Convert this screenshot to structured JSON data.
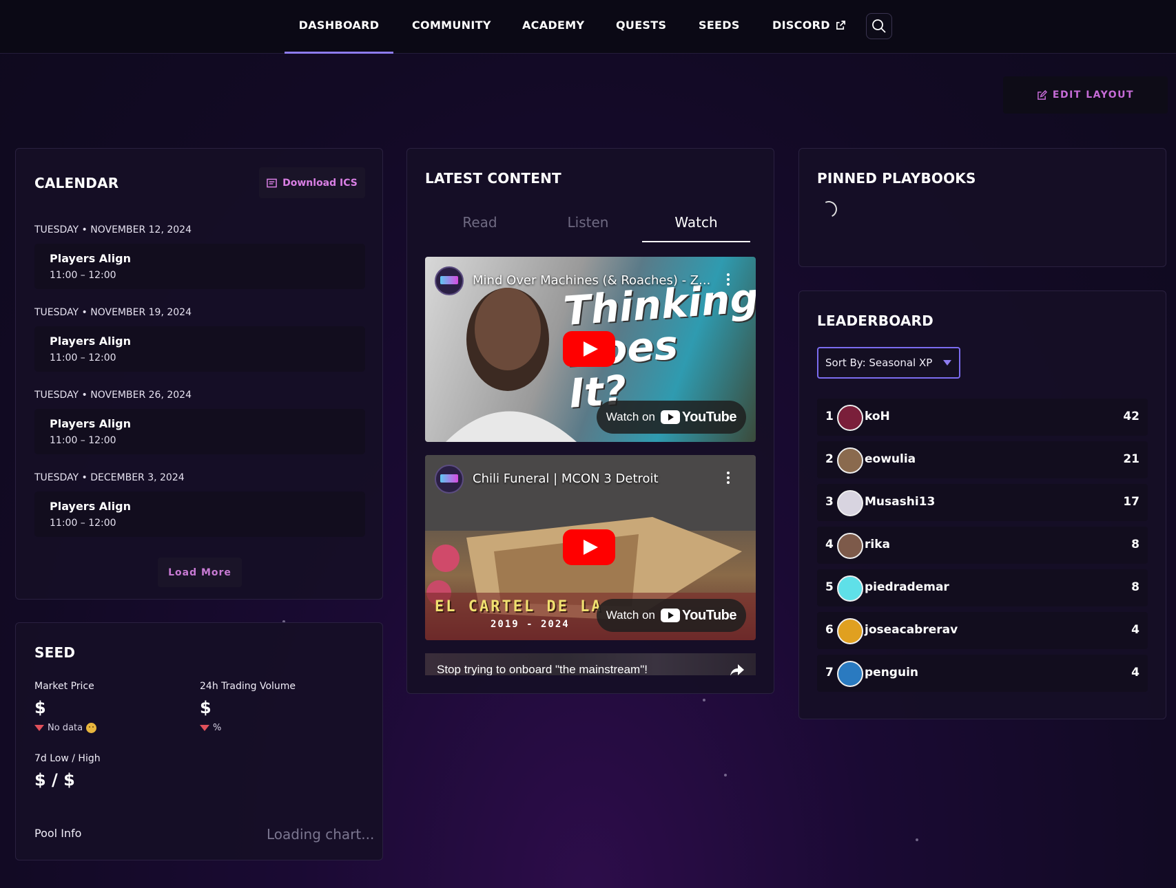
{
  "nav": {
    "items": [
      {
        "label": "DASHBOARD",
        "active": true
      },
      {
        "label": "COMMUNITY"
      },
      {
        "label": "ACADEMY"
      },
      {
        "label": "QUESTS"
      },
      {
        "label": "SEEDS"
      },
      {
        "label": "DISCORD",
        "external": true
      }
    ],
    "search_icon": "search-icon"
  },
  "edit_layout": {
    "label": "EDIT LAYOUT",
    "icon": "edit-icon"
  },
  "calendar": {
    "title": "CALENDAR",
    "download_label": "Download ICS",
    "events": [
      {
        "date": "TUESDAY • NOVEMBER 12, 2024",
        "title": "Players Align",
        "time": "11:00 – 12:00"
      },
      {
        "date": "TUESDAY • NOVEMBER 19, 2024",
        "title": "Players Align",
        "time": "11:00 – 12:00"
      },
      {
        "date": "TUESDAY • NOVEMBER 26, 2024",
        "title": "Players Align",
        "time": "11:00 – 12:00"
      },
      {
        "date": "TUESDAY • DECEMBER 3, 2024",
        "title": "Players Align",
        "time": "11:00 – 12:00"
      }
    ],
    "load_more": "Load More"
  },
  "seed": {
    "title": "SEED",
    "market_price_label": "Market Price",
    "market_price_value": "$",
    "market_price_change": "No data",
    "volume_label": "24h Trading Volume",
    "volume_value": "$",
    "volume_change": "%",
    "low_high_label": "7d Low / High",
    "low_high_value": "$ / $",
    "pool_info_label": "Pool Info",
    "pool_info_status": "Loading chart..."
  },
  "latest_content": {
    "title": "LATEST CONTENT",
    "tabs": [
      {
        "label": "Read"
      },
      {
        "label": "Listen"
      },
      {
        "label": "Watch",
        "active": true
      }
    ],
    "videos": [
      {
        "title": "Mind Over Machines (& Roaches) - Z...",
        "thumb_text": "Thinking Does It?",
        "watch_on": "Watch on",
        "yt": "YouTube"
      },
      {
        "title": "Chili Funeral | MCON 3 Detroit",
        "thumb_text": "EL CARTEL DE LA",
        "thumb_sub": "2019 - 2024",
        "watch_on": "Watch on",
        "yt": "YouTube"
      },
      {
        "title": "Stop trying to onboard \"the mainstream\"!"
      }
    ]
  },
  "pinned_playbooks": {
    "title": "PINNED PLAYBOOKS"
  },
  "leaderboard": {
    "title": "LEADERBOARD",
    "sort_label": "Sort By: Seasonal XP",
    "rows": [
      {
        "rank": "1",
        "name": "koH",
        "score": "42",
        "avatar_color": "#7a1f3a"
      },
      {
        "rank": "2",
        "name": "eowulia",
        "score": "21",
        "avatar_color": "#8a6a4e"
      },
      {
        "rank": "3",
        "name": "Musashi13",
        "score": "17",
        "avatar_color": "#d8d4e0"
      },
      {
        "rank": "4",
        "name": "rika",
        "score": "8",
        "avatar_color": "#7d5a4a"
      },
      {
        "rank": "5",
        "name": "piedrademar",
        "score": "8",
        "avatar_color": "#5fe0e8"
      },
      {
        "rank": "6",
        "name": "joseacabrerav",
        "score": "4",
        "avatar_color": "#e0a020"
      },
      {
        "rank": "7",
        "name": "penguin",
        "score": "4",
        "avatar_color": "#2a7ac0"
      }
    ]
  }
}
